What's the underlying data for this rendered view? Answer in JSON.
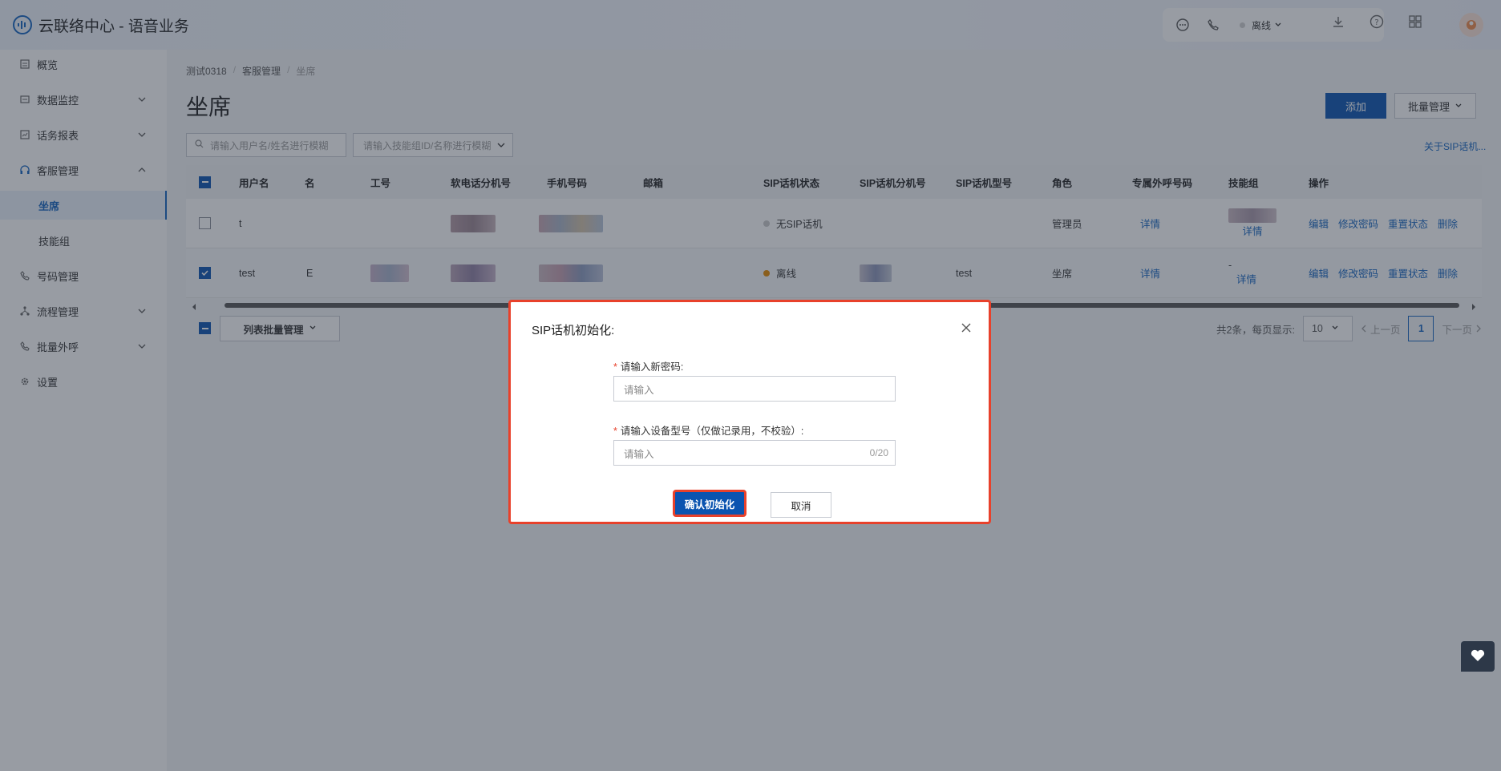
{
  "header": {
    "app_title": "云联络中心 - 语音业务",
    "status": "离线"
  },
  "sidebar": {
    "items": [
      {
        "label": "概览"
      },
      {
        "label": "数据监控"
      },
      {
        "label": "话务报表"
      },
      {
        "label": "客服管理"
      },
      {
        "label": "坐席"
      },
      {
        "label": "技能组"
      },
      {
        "label": "号码管理"
      },
      {
        "label": "流程管理"
      },
      {
        "label": "批量外呼"
      },
      {
        "label": "设置"
      }
    ]
  },
  "breadcrumb": [
    "测试0318",
    "客服管理",
    "坐席"
  ],
  "page": {
    "title": "坐席",
    "add_label": "添加",
    "batch_label": "批量管理",
    "search_placeholder": "请输入用户名/姓名进行模糊",
    "skill_placeholder": "请输入技能组ID/名称进行模糊",
    "sip_link": "关于SIP话机..."
  },
  "table": {
    "columns": [
      "用户名",
      "名",
      "工号",
      "软电话分机号",
      "手机号码",
      "邮箱",
      "SIP话机状态",
      "SIP话机分机号",
      "SIP话机型号",
      "角色",
      "专属外呼号码",
      "技能组",
      "操作"
    ],
    "rows": [
      {
        "username": "t",
        "sip_status": "无SIP话机",
        "sip_model": "",
        "role": "管理员",
        "detail": "详情",
        "skill_text": "",
        "skill_detail": "详情",
        "checked": false
      },
      {
        "username": "test",
        "name_frag": "E",
        "sip_status": "离线",
        "sip_model": "test",
        "role": "坐席",
        "detail": "详情",
        "skill_text": "-",
        "skill_detail": "详情",
        "checked": true
      }
    ],
    "ops": [
      "编辑",
      "修改密码",
      "重置状态",
      "删除"
    ]
  },
  "footer": {
    "list_batch_label": "列表批量管理",
    "total_text": "共2条，每页显示:",
    "page_size": "10",
    "prev": "上一页",
    "page": "1",
    "next": "下一页"
  },
  "dialog": {
    "title": "SIP话机初始化:",
    "field1_label": "请输入新密码:",
    "field1_placeholder": "请输入",
    "field2_label": "请输入设备型号（仅做记录用，不校验）:",
    "field2_placeholder": "请输入",
    "field2_count": "0/20",
    "confirm": "确认初始化",
    "cancel": "取消"
  }
}
